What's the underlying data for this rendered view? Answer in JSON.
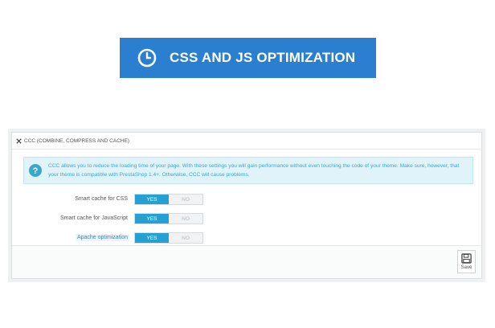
{
  "banner": {
    "title": "CSS AND JS OPTIMIZATION",
    "bg_color": "#2a7fd0",
    "icon": "clock-icon"
  },
  "panel": {
    "header": "CCC (COMBINE, COMPRESS AND CACHE)",
    "header_icon": "cogs-icon",
    "alert_text": "CCC allows you to reduce the loading time of your page. With these settings you will gain performance without even touching the code of your theme. Make sure, however, that your theme is compatible with PrestaShop 1.4+. Otherwise, CCC will cause problems.",
    "alert_icon": "question-circle-icon",
    "rows": [
      {
        "label": "Smart cache for CSS",
        "yes": "YES",
        "no": "NO",
        "selected": "yes"
      },
      {
        "label": "Smart cache for JavaScript",
        "yes": "YES",
        "no": "NO",
        "selected": "yes"
      },
      {
        "label": "Apache optimization",
        "yes": "YES",
        "no": "NO",
        "selected": "yes"
      }
    ],
    "save_label": "Save",
    "save_icon": "floppy-disk-icon",
    "accent_color": "#26a0d3"
  }
}
